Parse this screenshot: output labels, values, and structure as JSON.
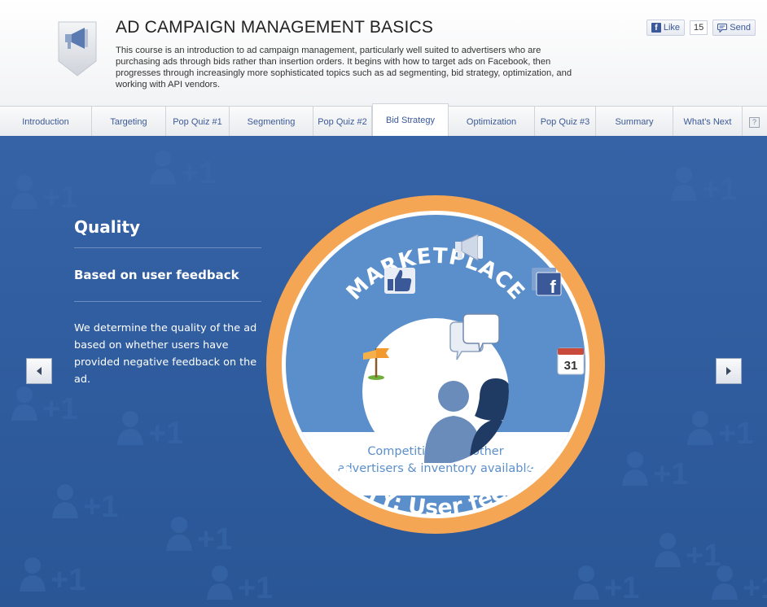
{
  "header": {
    "title": "AD CAMPAIGN MANAGEMENT BASICS",
    "description": "This course is an introduction to ad campaign management, particularly well suited to advertisers who are purchasing ads through bids rather than insertion orders. It begins with how to target ads on Facebook, then progresses through increasingly more sophisticated topics such as ad segmenting, bid strategy, optimization, and working with API vendors.",
    "like_label": "Like",
    "like_count": "15",
    "send_label": "Send"
  },
  "tabs": [
    {
      "label": "Introduction"
    },
    {
      "label": "Targeting"
    },
    {
      "label": "Pop Quiz #1"
    },
    {
      "label": "Segmenting"
    },
    {
      "label": "Pop Quiz #2"
    },
    {
      "label": "Bid Strategy"
    },
    {
      "label": "Optimization"
    },
    {
      "label": "Pop Quiz #3"
    },
    {
      "label": "Summary"
    },
    {
      "label": "What's Next"
    }
  ],
  "active_tab": "Bid Strategy",
  "help_label": "?",
  "content": {
    "title": "Quality",
    "subtitle": "Based on user feedback",
    "body": "We determine the quality of the ad based on whether users have provided negative feedback on the ad."
  },
  "diagram": {
    "arc_top": "MARKETPLACE",
    "caption_line1": "Competition with other",
    "caption_line2": "advertisers & inventory available",
    "arc_bottom": "QUALITY:  User feedback",
    "calendar_day": "31",
    "colors": {
      "outer_ring": "#f5a654",
      "inner_circle": "#5b8fcb",
      "stage_bg": "#2f5d9e"
    }
  },
  "icons": [
    "megaphone-icon",
    "facebook-like-badge-icon",
    "thumbs-up-icon",
    "facebook-pages-icon",
    "flag-icon",
    "calendar-icon",
    "chat-bubbles-icon",
    "users-silhouette-icon"
  ]
}
